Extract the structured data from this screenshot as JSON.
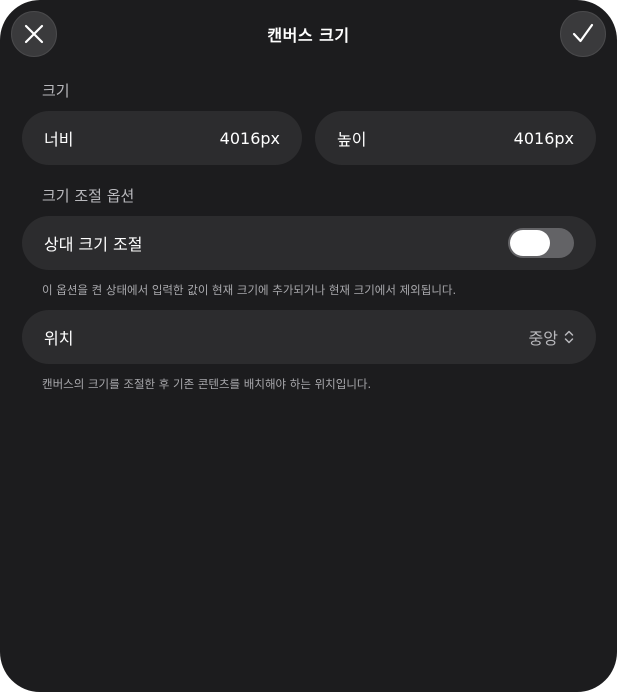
{
  "header": {
    "title": "캔버스 크기",
    "close_icon": "close-icon",
    "confirm_icon": "checkmark-icon"
  },
  "size_section": {
    "label": "크기",
    "width": {
      "label": "너비",
      "value": "4016px"
    },
    "height": {
      "label": "높이",
      "value": "4016px"
    }
  },
  "resize_section": {
    "label": "크기 조절 옵션",
    "relative": {
      "label": "상대 크기 조절",
      "enabled": false
    },
    "relative_note": "이 옵션을 켠 상태에서 입력한 값이 현재 크기에 추가되거나 현재 크기에서 제외됩니다.",
    "anchor": {
      "label": "위치",
      "value": "중앙",
      "icon": "chevron-updown-icon"
    },
    "anchor_note": "캔버스의 크기를 조절한 후 기존 콘텐츠를 배치해야 하는 위치입니다."
  },
  "colors": {
    "background": "#1c1c1e",
    "row": "#2c2c2e",
    "button": "#3a3a3c",
    "toggle_track": "#636366"
  }
}
